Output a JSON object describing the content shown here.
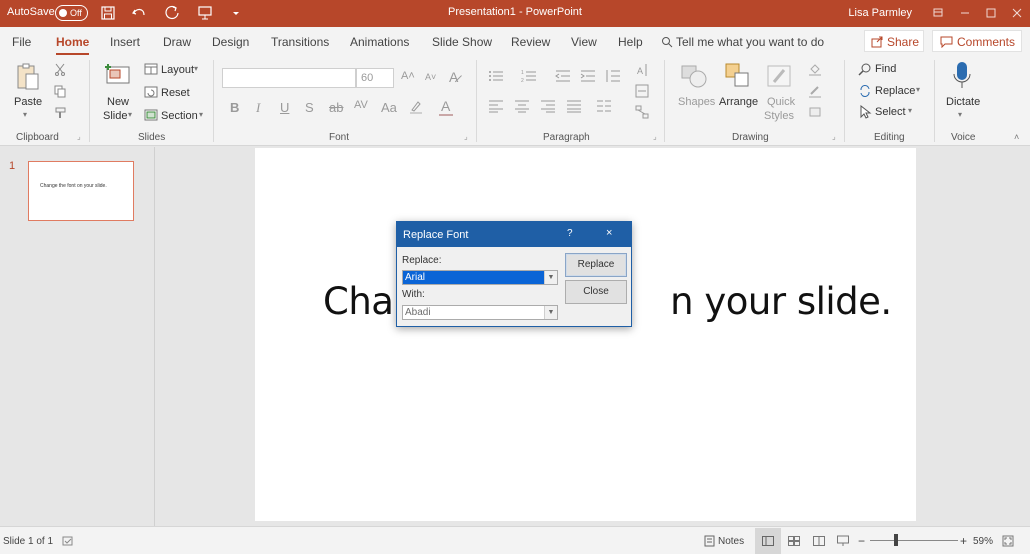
{
  "titlebar": {
    "autosave_label": "AutoSave",
    "autosave_state": "Off",
    "document_title": "Presentation1  -  PowerPoint",
    "user_name": "Lisa Parmley",
    "color": "#b7472a"
  },
  "tabs": [
    {
      "label": "File"
    },
    {
      "label": "Home",
      "active": true
    },
    {
      "label": "Insert"
    },
    {
      "label": "Draw"
    },
    {
      "label": "Design"
    },
    {
      "label": "Transitions"
    },
    {
      "label": "Animations"
    },
    {
      "label": "Slide Show"
    },
    {
      "label": "Review"
    },
    {
      "label": "View"
    },
    {
      "label": "Help"
    }
  ],
  "tell_me": "Tell me what you want to do",
  "share_label": "Share",
  "comments_label": "Comments",
  "ribbon": {
    "clipboard": {
      "paste": "Paste",
      "group": "Clipboard"
    },
    "slides": {
      "new_slide_1": "New",
      "new_slide_2": "Slide",
      "layout": "Layout",
      "reset": "Reset",
      "section": "Section",
      "group": "Slides"
    },
    "font": {
      "size_value": "60",
      "group": "Font"
    },
    "paragraph": {
      "group": "Paragraph"
    },
    "drawing": {
      "shapes": "Shapes",
      "arrange": "Arrange",
      "quick_styles_1": "Quick",
      "quick_styles_2": "Styles",
      "group": "Drawing"
    },
    "editing": {
      "find": "Find",
      "replace": "Replace",
      "select": "Select",
      "group": "Editing"
    },
    "voice": {
      "dictate": "Dictate",
      "group": "Voice"
    }
  },
  "thumbnails": [
    {
      "number": "1",
      "text": "Change the font on your slide."
    }
  ],
  "slide": {
    "visible_text_left": "Char",
    "visible_text_right": "n your slide."
  },
  "dialog": {
    "title": "Replace Font",
    "help": "?",
    "close_glyph": "×",
    "replace_label": "Replace:",
    "replace_value": "Arial",
    "with_label": "With:",
    "with_value": "Abadi",
    "replace_button": "Replace",
    "close_button": "Close"
  },
  "statusbar": {
    "slide_info": "Slide 1 of 1",
    "notes": "Notes",
    "zoom": "59%",
    "zoom_level": 0.59
  }
}
